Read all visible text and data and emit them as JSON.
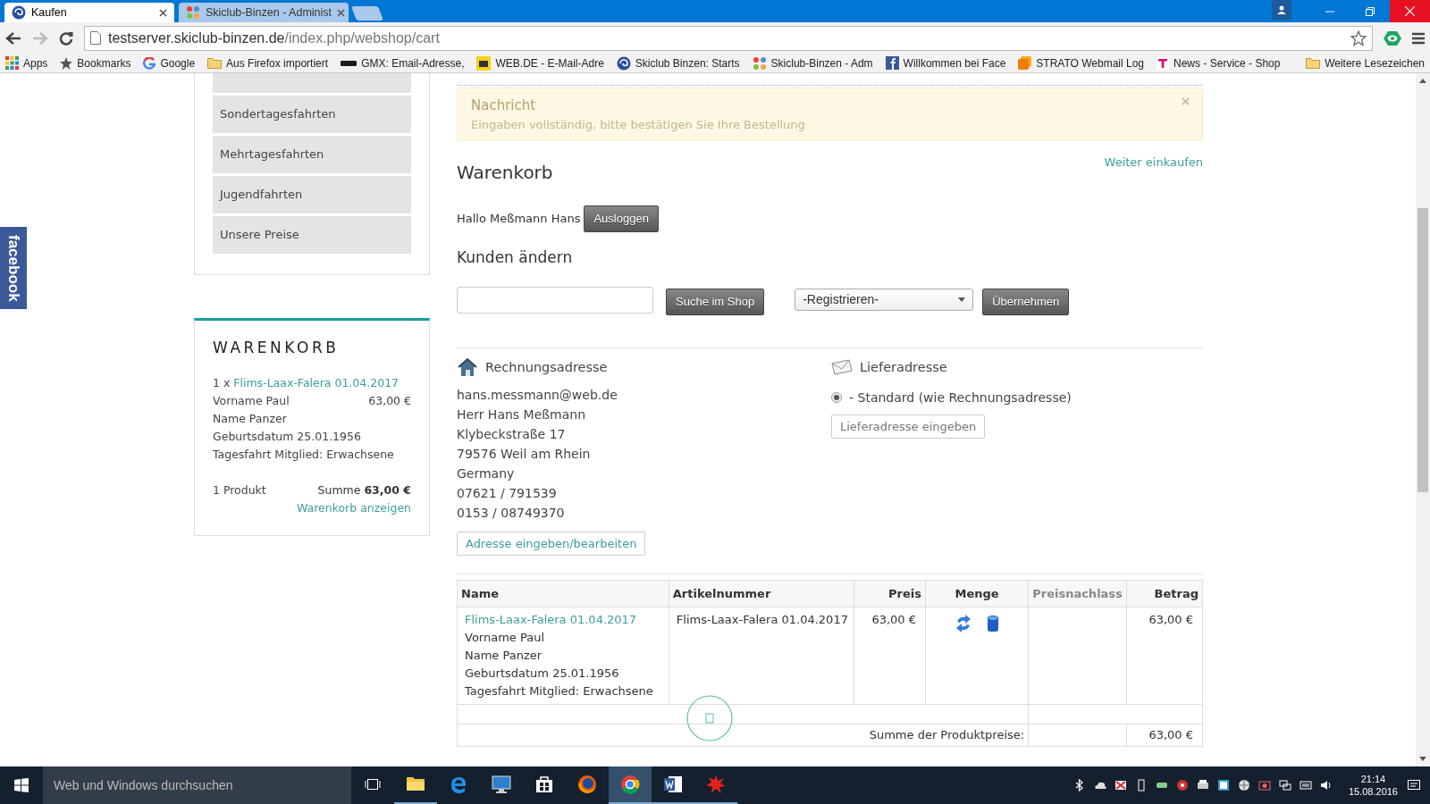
{
  "browser": {
    "tabs": [
      {
        "title": "Kaufen",
        "kind": "swirl",
        "selected": true
      },
      {
        "title": "Skiclub-Binzen - Administ",
        "kind": "joomla",
        "selected": false
      }
    ],
    "address": {
      "host": "testserver.skiclub-binzen.de",
      "path": "/index.php/webshop/cart"
    },
    "bookmarks": [
      {
        "label": "Apps",
        "kind": "apps"
      },
      {
        "label": "Bookmarks",
        "kind": "star"
      },
      {
        "label": "Google",
        "kind": "google"
      },
      {
        "label": "Aus Firefox importiert",
        "kind": "folder"
      },
      {
        "label": "GMX: Email-Adresse,",
        "kind": "gmx"
      },
      {
        "label": "WEB.DE - E-Mail-Adre",
        "kind": "webde"
      },
      {
        "label": "Skiclub Binzen: Starts",
        "kind": "swirl"
      },
      {
        "label": "Skiclub-Binzen - Adm",
        "kind": "joomla"
      },
      {
        "label": "Willkommen bei Face",
        "kind": "facebook"
      },
      {
        "label": "STRATO Webmail Log",
        "kind": "strato"
      },
      {
        "label": "News - Service - Shop",
        "kind": "telekom"
      }
    ],
    "other_bookmarks": "Weitere Lesezeichen"
  },
  "facebook_tab": {
    "label": "facebook"
  },
  "sidebar": {
    "menu": [
      "Sondertagesfahrten",
      "Mehrtagesfahrten",
      "Jugendfahrten",
      "Unsere Preise"
    ],
    "cart": {
      "title": "WARENKORB",
      "qty": "1 x ",
      "item_link": "Flims-Laax-Falera 01.04.2017",
      "price": "63,00 €",
      "details": [
        "Vorname Paul",
        "Name Panzer",
        "Geburtsdatum 25.01.1956",
        "Tagesfahrt Mitglied: Erwachsene"
      ],
      "count": "1 Produkt",
      "sum": "Summe **63,00 €**",
      "show_link": "Warenkorb anzeigen"
    }
  },
  "main": {
    "alert": {
      "title": "Nachricht",
      "text": "Eingaben vollständig, bitte bestätigen Sie Ihre Bestellung"
    },
    "heading": "Warenkorb",
    "continue_link": "Weiter einkaufen",
    "greeting": "Hallo Meßmann Hans",
    "logout_button": "Ausloggen",
    "customer_heading": "Kunden ändern",
    "search_button": "Suche im Shop",
    "register_select": "-Registrieren-",
    "apply_button": "Übernehmen",
    "billing": {
      "heading": "Rechnungsadresse",
      "lines": [
        "hans.messmann@web.de",
        "Herr Hans Meßmann",
        "Klybeckstraße 17",
        "79576 Weil am Rhein",
        "Germany",
        "07621 / 791539",
        "0153 / 08749370"
      ],
      "edit_button": "Adresse eingeben/bearbeiten"
    },
    "shipping": {
      "heading": "Lieferadresse",
      "options": [
        {
          "label": "- Standard (wie Rechnungsadresse)",
          "selected": true
        }
      ],
      "enter_button": "Lieferadresse eingeben"
    },
    "table": {
      "columns": [
        {
          "label": "Name",
          "disabled": false
        },
        {
          "label": "Artikelnummer",
          "disabled": false
        },
        {
          "label": "Preis",
          "disabled": false
        },
        {
          "label": "Menge",
          "disabled": false
        },
        {
          "label": "Preisnachlass",
          "disabled": true
        },
        {
          "label": "Betrag",
          "disabled": false
        }
      ],
      "rows": [
        {
          "name": "Flims-Laax-Falera 01.04.2017",
          "details": [
            "Vorname Paul",
            "Name Panzer",
            "Geburtsdatum 25.01.1956",
            "Tagesfahrt Mitglied: Erwachsene"
          ],
          "article": "Flims-Laax-Falera 01.04.2017",
          "price": "63,00 €",
          "amount": "63,00 €"
        }
      ],
      "sum_label": "Summe der Produktpreise:",
      "sum_amount": "63,00 €"
    }
  },
  "taskbar": {
    "search_placeholder": "Web und Windows durchsuchen",
    "apps": [
      {
        "kind": "explorer",
        "running": true,
        "selected": false
      },
      {
        "kind": "edge",
        "running": false,
        "selected": false
      },
      {
        "kind": "monitor",
        "running": false,
        "selected": false
      },
      {
        "kind": "store",
        "running": false,
        "selected": false
      },
      {
        "kind": "firefox",
        "running": false,
        "selected": false
      },
      {
        "kind": "chrome",
        "running": true,
        "selected": true
      },
      {
        "kind": "word",
        "running": true,
        "selected": false
      },
      {
        "kind": "redapp",
        "running": true,
        "selected": false
      }
    ],
    "time": "21:14",
    "date": "15.08.2016"
  }
}
